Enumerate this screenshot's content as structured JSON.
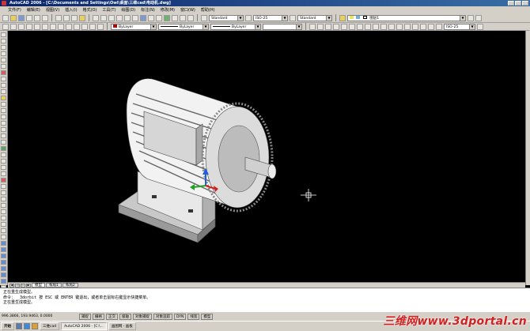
{
  "window": {
    "title": "AutoCAD 2006 - [C:\\Documents and Settings\\Owl\\桌面\\三维cad\\电动机.dwg]"
  },
  "menubar": {
    "items": [
      "文件(F)",
      "编辑(E)",
      "视图(V)",
      "插入(I)",
      "格式(O)",
      "工具(T)",
      "绘图(D)",
      "标注(N)",
      "修改(M)",
      "窗口(W)",
      "帮助(H)"
    ]
  },
  "toolbar": {
    "text_style": "Standard",
    "dim_style": "ISO-25",
    "table_style": "Standard",
    "layer": "图层1",
    "color": "ByLayer",
    "linetype": "ByLayer",
    "lineweight": "ByLayer",
    "dim_style_right": "ISO-25"
  },
  "layout_tabs": {
    "nav": [
      "◀",
      "◁",
      "▷",
      "▶"
    ],
    "tabs": [
      "模型",
      "布局1",
      "布局2"
    ]
  },
  "command": {
    "lines": [
      "正在重生成模型。",
      "命令： _3dorbit 按 ESC 或 ENTER 键退出，或者单击鼠标右键显示快捷菜单。",
      "正在重生成模型。"
    ]
  },
  "statusbar": {
    "coordinates": "996.3866, 193.9463, 0.0000",
    "buttons": [
      "捕捉",
      "栅格",
      "正交",
      "极轴",
      "对象捕捉",
      "对象追踪",
      "DYN",
      "线宽",
      "模型"
    ]
  },
  "taskbar": {
    "start": "开始",
    "tasks": [
      "三维cad",
      "AutoCAD 2006 - [C:\\...",
      "画图网 - 画板"
    ]
  },
  "watermark": {
    "text": "三维网www.3dportal.cn"
  },
  "colors": {
    "background": "#000000",
    "chrome": "#d4d0c8",
    "title_bar": "#0a246a",
    "watermark": "#d42020"
  }
}
